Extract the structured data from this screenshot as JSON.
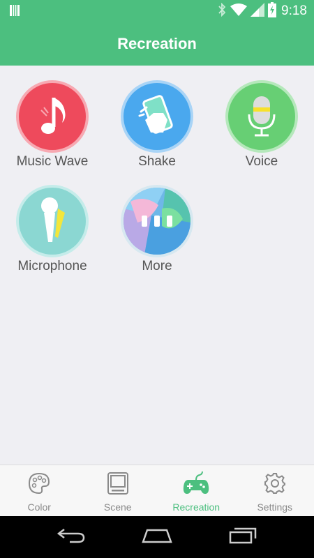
{
  "status_bar": {
    "time": "9:18",
    "icons": [
      "notification-icon",
      "bluetooth-icon",
      "wifi-icon",
      "signal-icon",
      "battery-icon"
    ]
  },
  "header": {
    "title": "Recreation"
  },
  "tiles": [
    {
      "label": "Music Wave",
      "icon": "music-note-icon",
      "color": "#ee4a5c"
    },
    {
      "label": "Shake",
      "icon": "shake-phone-icon",
      "color": "#4aa8ee"
    },
    {
      "label": "Voice",
      "icon": "voice-mic-icon",
      "color": "#67cf74"
    },
    {
      "label": "Microphone",
      "icon": "microphone-icon",
      "color": "#8bd7d2"
    },
    {
      "label": "More",
      "icon": "more-icon",
      "color": "#6fb7e8"
    }
  ],
  "bottom_nav": [
    {
      "label": "Color",
      "icon": "palette-icon",
      "active": false
    },
    {
      "label": "Scene",
      "icon": "tv-icon",
      "active": false
    },
    {
      "label": "Recreation",
      "icon": "gamepad-icon",
      "active": true
    },
    {
      "label": "Settings",
      "icon": "gear-icon",
      "active": false
    }
  ],
  "colors": {
    "accent": "#4cbf7f",
    "inactive": "#8a8a8a",
    "background": "#efeff3"
  }
}
